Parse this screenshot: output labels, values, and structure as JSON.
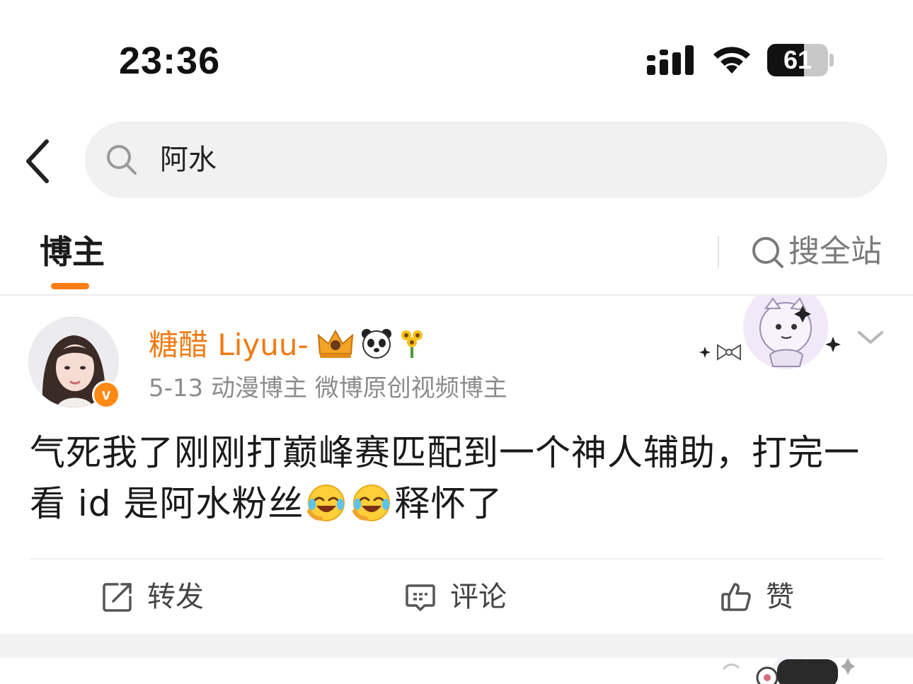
{
  "status_bar": {
    "time": "23:36",
    "battery_percent": "61",
    "battery_level": 0.61
  },
  "search": {
    "query": "阿水"
  },
  "tabs": {
    "active_tab": "博主",
    "search_all_label": "搜全站"
  },
  "post": {
    "author_name": "糖醋 Liyuu-",
    "verified_mark": "v",
    "meta": "5-13  动漫博主 微博原创视频博主",
    "text_part1": "气死我了刚刚打巅峰赛匹配到一个神人辅助，打完一看 id 是阿水粉丝",
    "text_part2": "释怀了",
    "actions": {
      "repost": "转发",
      "comment": "评论",
      "like": "赞"
    }
  },
  "icons": {
    "back": "chevron-left-icon",
    "search": "search-icon",
    "crown_badge": "crown-icon",
    "panda_badge": "panda-icon",
    "flower_badge": "sunflower-icon",
    "emoji": "laughing-crying-emoji",
    "repost": "repost-icon",
    "comment": "comment-icon",
    "like": "thumbs-up-icon",
    "more": "chevron-down-icon"
  },
  "colors": {
    "accent_orange": "#ff7d14",
    "username_orange": "#f07b14",
    "meta_gray": "#8c8c8c",
    "search_bg": "#f1f1f1"
  }
}
